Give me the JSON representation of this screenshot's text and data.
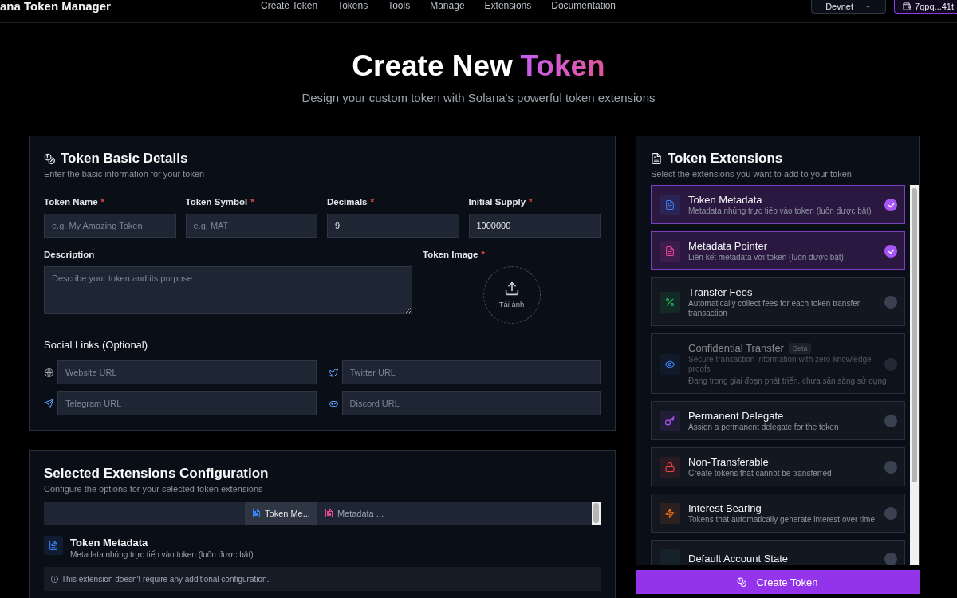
{
  "header": {
    "brand": "ana Token Manager",
    "nav": [
      {
        "label": "Create Token"
      },
      {
        "label": "Tokens"
      },
      {
        "label": "Tools"
      },
      {
        "label": "Manage"
      },
      {
        "label": "Extensions"
      },
      {
        "label": "Documentation"
      }
    ],
    "network": "Devnet",
    "wallet": "7qpq...41t"
  },
  "hero": {
    "title": "Create New",
    "title_highlight": "Token",
    "subtitle": "Design your custom token with Solana's powerful token extensions"
  },
  "basic_details": {
    "title": "Token Basic Details",
    "subtitle": "Enter the basic information for your token",
    "fields": [
      {
        "label": "Token Name",
        "required_mark": "*",
        "placeholder": "e.g. My Amazing Token"
      },
      {
        "label": "Token Symbol",
        "required_mark": "*",
        "placeholder": "e.g. MAT"
      },
      {
        "label": "Decimals",
        "required_mark": "*",
        "value": "9"
      },
      {
        "label": "Initial Supply",
        "required_mark": "*",
        "value": "1000000"
      }
    ],
    "description": {
      "label": "Description",
      "placeholder": "Describe your token and its purpose"
    },
    "image": {
      "label": "Token Image",
      "required_mark": "*",
      "button": "Tải ảnh"
    },
    "social": {
      "title": "Social Links (Optional)",
      "links": [
        {
          "placeholder": "Website URL"
        },
        {
          "placeholder": "Twitter URL"
        },
        {
          "placeholder": "Telegram URL"
        },
        {
          "placeholder": "Discord URL"
        }
      ]
    }
  },
  "extensions_config": {
    "title": "Selected Extensions Configuration",
    "subtitle": "Configure the options for your selected token extensions",
    "tabs": [
      {
        "label": "Token Me...",
        "selected": true,
        "color": "#3b82f6"
      },
      {
        "label": "Metadata ...",
        "selected": false,
        "color": "#ec4899"
      }
    ],
    "detail": {
      "title": "Token Metadata",
      "description": "Metadata nhúng trực tiếp vào token (luôn được bật)",
      "color": "#3b82f6",
      "note": "This extension doesn't require any additional configuration."
    }
  },
  "extensions": {
    "title": "Token Extensions",
    "subtitle": "Select the extensions you want to add to your token",
    "items": [
      {
        "title": "Token Metadata",
        "description": "Metadata nhúng trực tiếp vào token (luôn được bật)",
        "color": "#3b82f6",
        "selected": true,
        "disabled": false
      },
      {
        "title": "Metadata Pointer",
        "description": "Liên kết metadata với token (luôn được bật)",
        "color": "#ec4899",
        "selected": true,
        "disabled": false
      },
      {
        "title": "Transfer Fees",
        "description": "Automatically collect fees for each token transfer transaction",
        "color": "#22c55e",
        "selected": false,
        "disabled": false
      },
      {
        "title": "Confidential Transfer",
        "badge": "Beta",
        "description": "Secure transaction information with zero-knowledge proofs",
        "note": "Đang trong giai đoạn phát triển, chưa sẵn sàng sử dụng",
        "color": "#3b82f6",
        "selected": false,
        "disabled": true
      },
      {
        "title": "Permanent Delegate",
        "description": "Assign a permanent delegate for the token",
        "color": "#a855f7",
        "selected": false,
        "disabled": false
      },
      {
        "title": "Non-Transferable",
        "description": "Create tokens that cannot be transferred",
        "color": "#ef4444",
        "selected": false,
        "disabled": false
      },
      {
        "title": "Interest Bearing",
        "description": "Tokens that automatically generate interest over time",
        "color": "#f97316",
        "selected": false,
        "disabled": false
      },
      {
        "title": "Default Account State",
        "selected": false,
        "disabled": false
      }
    ]
  },
  "create_button": "Create Token"
}
